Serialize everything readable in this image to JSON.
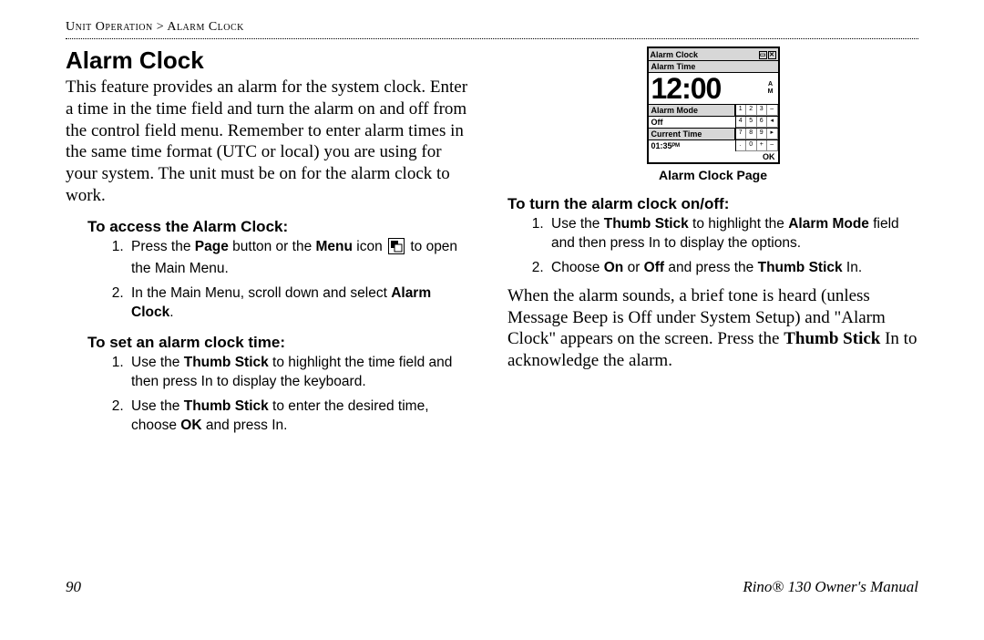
{
  "breadcrumb": "Unit Operation > Alarm Clock",
  "title": "Alarm Clock",
  "intro": "This feature provides an alarm for the system clock. Enter a time in the time field and turn the alarm on and off from the control field menu. Remember to enter alarm times in the same time format (UTC or local) you are using for your system. The unit must be on for the alarm clock to work.",
  "left": {
    "sub1": "To access the Alarm Clock:",
    "step1a": "Press the ",
    "step1b": "Page",
    "step1c": " button or the ",
    "step1d": "Menu",
    "step1e": " icon ",
    "step1f": " to open the Main Menu.",
    "step2a": "In the Main Menu, scroll down and select ",
    "step2b": "Alarm Clock",
    "step2c": ".",
    "sub2": "To set an alarm clock time:",
    "setStep1a": "Use the ",
    "setStep1b": "Thumb Stick",
    "setStep1c": " to highlight the time field and then press In to display the keyboard.",
    "setStep2a": "Use the ",
    "setStep2b": "Thumb Stick",
    "setStep2c": " to enter the desired time, choose ",
    "setStep2d": "OK",
    "setStep2e": " and press In."
  },
  "right": {
    "figureCaption": "Alarm Clock Page",
    "sub1": "To turn the alarm clock on/off:",
    "onStep1a": "Use the ",
    "onStep1b": "Thumb Stick",
    "onStep1c": " to highlight the ",
    "onStep1d": "Alarm Mode",
    "onStep1e": " field and then press In to display the options.",
    "onStep2a": "Choose ",
    "onStep2b": "On",
    "onStep2c": " or ",
    "onStep2d": "Off",
    "onStep2e": " and press the ",
    "onStep2f": "Thumb Stick",
    "onStep2g": " In.",
    "para2a": "When the alarm sounds, a brief tone is heard (unless Message Beep is Off under System Setup) and \"Alarm Clock\" appears on the screen. Press the ",
    "para2b": "Thumb Stick",
    "para2c": " In to acknowledge the alarm."
  },
  "device": {
    "title": "Alarm Clock",
    "alarmTimeLabel": "Alarm Time",
    "time": "12:00",
    "am": "A",
    "pm": "M",
    "alarmModeLabel": "Alarm Mode",
    "alarmModeVal": "Off",
    "currentTimeLabel": "Current Time",
    "currentTimeVal": "01:35ᴾᴹ",
    "ok": "OK",
    "keys1": [
      "1",
      "2",
      "3",
      "–"
    ],
    "keys2": [
      "4",
      "5",
      "6",
      "◂"
    ],
    "keys3": [
      "7",
      "8",
      "9",
      "▸"
    ],
    "keys4": [
      ".",
      "0",
      "+",
      "–"
    ]
  },
  "footer": {
    "pageNum": "90",
    "manual": "Rino® 130 Owner's Manual"
  }
}
